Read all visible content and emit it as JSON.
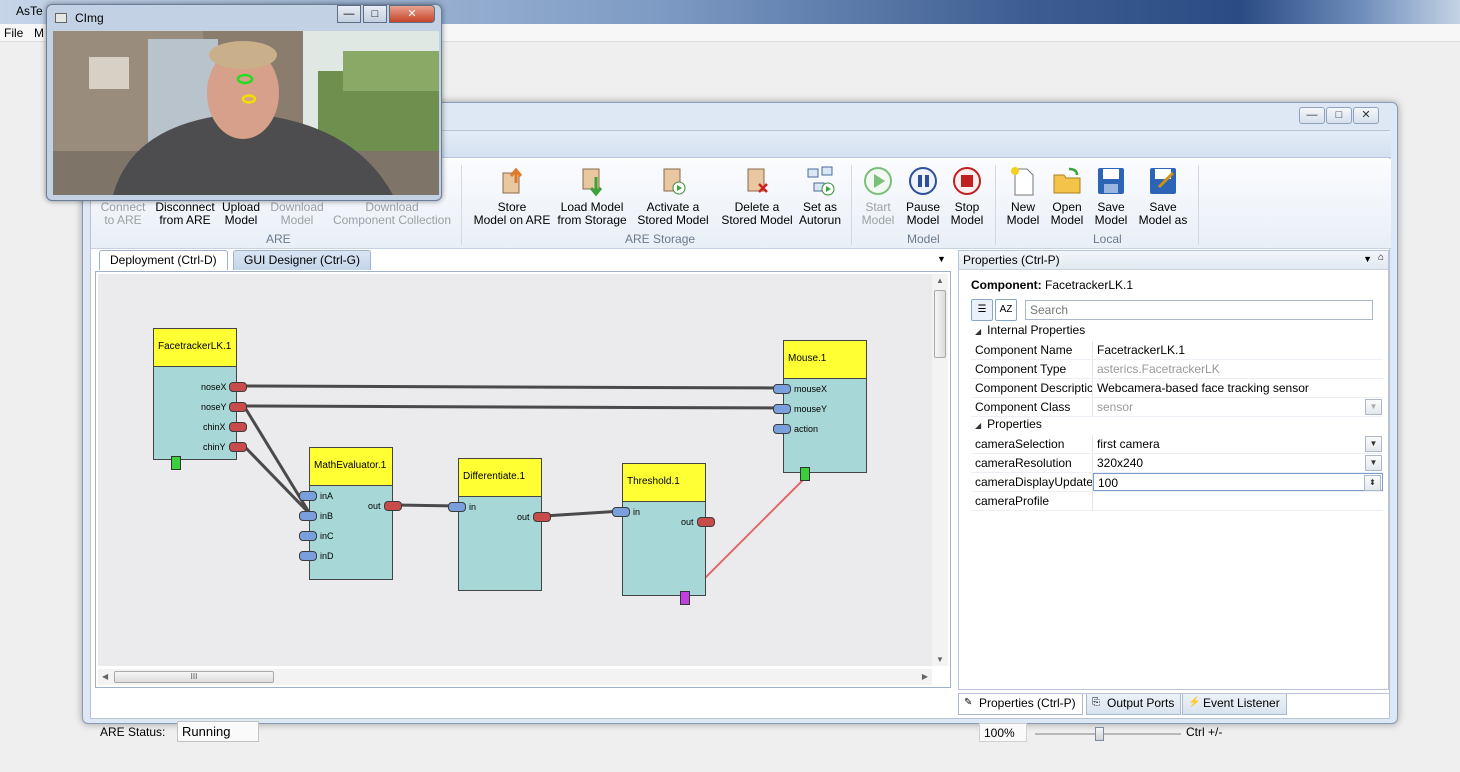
{
  "background_app": {
    "title": "AsTe",
    "menus": [
      "File",
      "M"
    ]
  },
  "cimg_window": {
    "title": "CImg",
    "controls": {
      "minimize": "—",
      "maximize": "□",
      "close": "✕"
    }
  },
  "main_window": {
    "controls": {
      "minimize": "—",
      "maximize": "□",
      "close": "✕"
    }
  },
  "ribbon": {
    "are_group": {
      "label": "ARE",
      "buttons": [
        {
          "line1": "Connect",
          "line2": "to ARE",
          "enabled": false,
          "icon": "connect-icon"
        },
        {
          "line1": "Disconnect",
          "line2": "from ARE",
          "enabled": true,
          "icon": "disconnect-icon"
        },
        {
          "line1": "Upload",
          "line2": "Model",
          "enabled": true,
          "icon": "upload-icon"
        },
        {
          "line1": "Download",
          "line2": "Model",
          "enabled": false,
          "icon": "download-icon"
        },
        {
          "line1": "Download",
          "line2": "Component Collection",
          "enabled": false,
          "icon": "download-collection-icon"
        }
      ]
    },
    "storage_group": {
      "label": "ARE Storage",
      "buttons": [
        {
          "line1": "Store",
          "line2": "Model on ARE",
          "icon": "store-icon"
        },
        {
          "line1": "Load Model",
          "line2": "from Storage",
          "icon": "load-icon"
        },
        {
          "line1": "Activate a",
          "line2": "Stored Model",
          "icon": "activate-icon"
        },
        {
          "line1": "Delete a",
          "line2": "Stored Model",
          "icon": "delete-icon"
        },
        {
          "line1": "Set as",
          "line2": "Autorun",
          "icon": "autorun-icon"
        }
      ]
    },
    "model_group": {
      "label": "Model",
      "buttons": [
        {
          "line1": "Start",
          "line2": "Model",
          "enabled": false,
          "icon": "play-icon"
        },
        {
          "line1": "Pause",
          "line2": "Model",
          "enabled": true,
          "icon": "pause-icon"
        },
        {
          "line1": "Stop",
          "line2": "Model",
          "enabled": true,
          "icon": "stop-icon"
        }
      ]
    },
    "local_group": {
      "label": "Local",
      "buttons": [
        {
          "line1": "New",
          "line2": "Model",
          "icon": "new-icon"
        },
        {
          "line1": "Open",
          "line2": "Model",
          "icon": "open-icon"
        },
        {
          "line1": "Save",
          "line2": "Model",
          "icon": "save-icon"
        },
        {
          "line1": "Save",
          "line2": "Model as",
          "icon": "save-as-icon"
        }
      ]
    }
  },
  "doc_tabs": {
    "deployment": "Deployment (Ctrl-D)",
    "gui_designer": "GUI Designer (Ctrl-G)",
    "menu_glyph": "▼"
  },
  "canvas": {
    "scroll_grip": "III",
    "nodes": {
      "facetracker": {
        "title": "FacetrackerLK.1",
        "ports_out": [
          "noseX",
          "noseY",
          "chinX",
          "chinY"
        ]
      },
      "mouse": {
        "title": "Mouse.1",
        "ports_in": [
          "mouseX",
          "mouseY",
          "action"
        ]
      },
      "math": {
        "title": "MathEvaluator.1",
        "ports_in": [
          "inA",
          "inB",
          "inC",
          "inD"
        ],
        "ports_out": [
          "out"
        ]
      },
      "diff": {
        "title": "Differentiate.1",
        "ports_in": [
          "in"
        ],
        "ports_out": [
          "out"
        ]
      },
      "threshold": {
        "title": "Threshold.1",
        "ports_in": [
          "in"
        ],
        "ports_out": [
          "out"
        ]
      }
    },
    "colors": {
      "data_channel": "#4a4a4a",
      "event_channel": "#e06a6a",
      "node_header": "#ffff33",
      "node_body": "#a8d7d7"
    }
  },
  "status": {
    "label": "ARE Status:",
    "value": "Running"
  },
  "properties": {
    "header": "Properties (Ctrl-P)",
    "header_glyphs": {
      "menu": "▼",
      "pin": "⌂"
    },
    "component_label": "Component:",
    "component_name": "FacetrackerLK.1",
    "tool_icons": {
      "categorized": "☰",
      "alphabetical": "AZ"
    },
    "search_placeholder": "Search",
    "internal_section": "Internal Properties",
    "internal": [
      {
        "name": "Component Name",
        "value": "FacetrackerLK.1",
        "readonly": false
      },
      {
        "name": "Component Type",
        "value": "asterics.FacetrackerLK",
        "readonly": true
      },
      {
        "name": "Component Descriptic",
        "value": "Webcamera-based face tracking sensor",
        "readonly": false
      },
      {
        "name": "Component Class",
        "value": "sensor",
        "readonly": true
      }
    ],
    "properties_section": "Properties",
    "props": [
      {
        "name": "cameraSelection",
        "value": "first camera"
      },
      {
        "name": "cameraResolution",
        "value": "320x240"
      },
      {
        "name": "cameraDisplayUpdate",
        "value": "100"
      },
      {
        "name": "cameraProfile",
        "value": ""
      }
    ],
    "dropdown_glyph": "▼",
    "spinner_glyph": "⬍",
    "bottom_tabs": [
      "Properties (Ctrl-P)",
      "Output Ports",
      "Event Listener"
    ]
  },
  "zoom": {
    "value": "100%",
    "level_percent": 100,
    "hint": "Ctrl +/-"
  }
}
